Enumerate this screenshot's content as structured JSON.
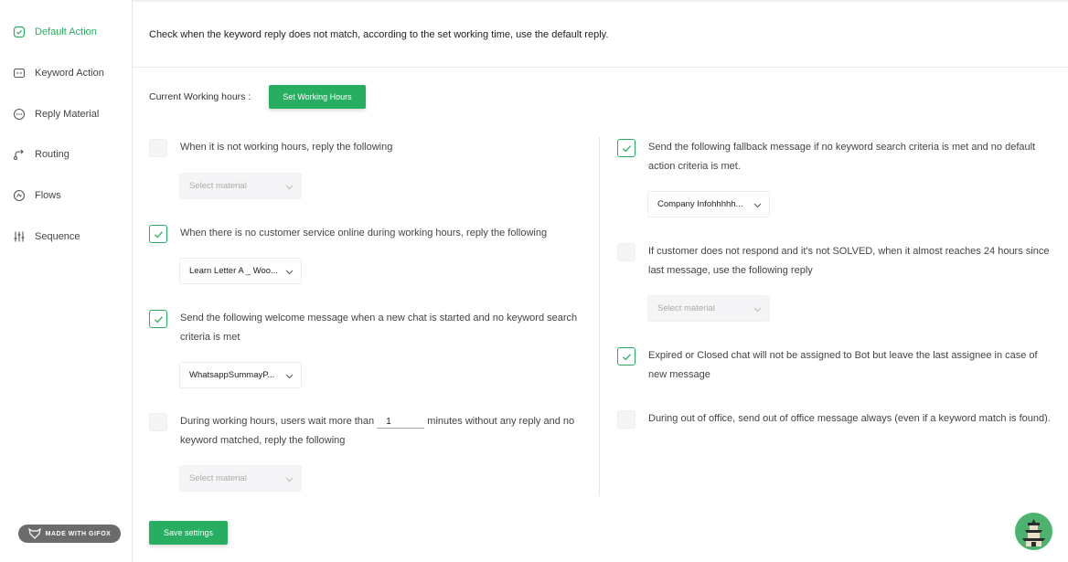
{
  "sidebar": {
    "items": [
      {
        "label": "Default Action",
        "icon": "message-check-icon",
        "active": true
      },
      {
        "label": "Keyword Action",
        "icon": "keyword-icon"
      },
      {
        "label": "Reply Material",
        "icon": "chat-bubble-icon"
      },
      {
        "label": "Routing",
        "icon": "routing-icon"
      },
      {
        "label": "Flows",
        "icon": "flows-icon"
      },
      {
        "label": "Sequence",
        "icon": "sliders-icon"
      }
    ],
    "badge": "MADE WITH GIFOX"
  },
  "header": {
    "description": "Check when the keyword reply does not match, according to the set working time, use the default reply."
  },
  "working_hours": {
    "label": "Current Working hours :",
    "button": "Set Working Hours"
  },
  "left_options": [
    {
      "text": "When it is not working hours, reply the following",
      "checked": false,
      "select": "Select material",
      "select_disabled": true
    },
    {
      "text": "When there is no customer service online during working hours, reply the following",
      "checked": true,
      "select": "Learn Letter A _ Woo...",
      "select_disabled": false
    },
    {
      "text": "Send the following welcome message when a new chat is started and no keyword search criteria is met",
      "checked": true,
      "select": "WhatsappSummayP...",
      "select_disabled": false
    },
    {
      "text_before": "During working hours, users wait more than",
      "input_value": "1",
      "text_after": "minutes without any reply and no keyword matched, reply the following",
      "checked": false,
      "select": "Select material",
      "select_disabled": true
    }
  ],
  "right_options": [
    {
      "text": "Send the following fallback message if no keyword search criteria is met and no default action criteria is met.",
      "checked": true,
      "select": "Company Infohhhhh...",
      "select_disabled": false
    },
    {
      "text": "If customer does not respond and it's not SOLVED, when it almost reaches 24 hours since last message, use the following reply",
      "checked": false,
      "select": "Select material",
      "select_disabled": true
    },
    {
      "text": "Expired or Closed chat will not be assigned to Bot but leave the last assignee in case of new message",
      "checked": true
    },
    {
      "text": "During out of office, send out of office message always (even if a keyword match is found).",
      "checked": false
    }
  ],
  "save_button": "Save settings",
  "colors": {
    "accent": "#27ae60",
    "muted_bg": "#f5f5f7"
  }
}
